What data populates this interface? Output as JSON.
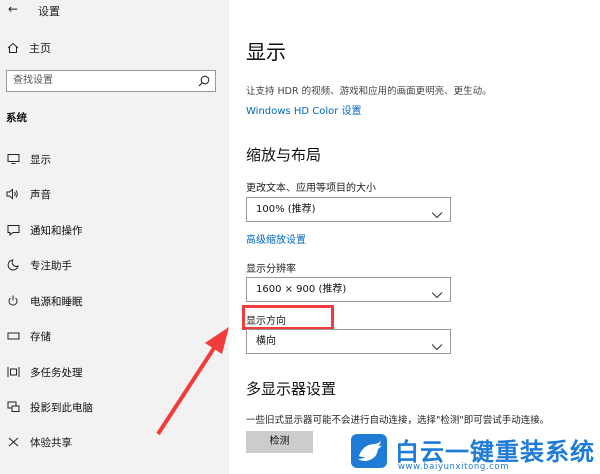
{
  "window": {
    "title": "设置",
    "back_glyph": "←"
  },
  "sidebar": {
    "home_label": "主页",
    "search_placeholder": "查找设置",
    "section_label": "系统",
    "items": [
      {
        "label": "显示",
        "icon": "monitor-icon"
      },
      {
        "label": "声音",
        "icon": "speaker-icon"
      },
      {
        "label": "通知和操作",
        "icon": "notification-icon"
      },
      {
        "label": "专注助手",
        "icon": "moon-icon"
      },
      {
        "label": "电源和睡眠",
        "icon": "power-icon"
      },
      {
        "label": "存储",
        "icon": "storage-icon"
      },
      {
        "label": "多任务处理",
        "icon": "multitask-icon"
      },
      {
        "label": "投影到此电脑",
        "icon": "project-icon"
      },
      {
        "label": "体验共享",
        "icon": "share-icon"
      }
    ]
  },
  "main": {
    "title": "显示",
    "hdr_description": "让支持 HDR 的视频、游戏和应用的画面更明亮、更生动。",
    "hdr_link": "Windows HD Color 设置",
    "scale_heading": "缩放与布局",
    "text_size_label": "更改文本、应用等项目的大小",
    "text_size_value": "100% (推荐)",
    "advanced_scaling_link": "高级缩放设置",
    "resolution_label": "显示分辨率",
    "resolution_value": "1600 × 900 (推荐)",
    "orientation_label": "显示方向",
    "orientation_value": "横向",
    "multi_heading": "多显示器设置",
    "multi_description": "一些旧式显示器可能不会进行自动连接，选择\"检测\"即可尝试手动连接。",
    "detect_button": "检测"
  },
  "watermark": {
    "title": "白云一键重装系统",
    "url": "www.baiyunxitong.com"
  },
  "colors": {
    "accent_link": "#0067c0",
    "annotation_red": "#f23b3b",
    "watermark_blue": "#1e7bd6"
  }
}
